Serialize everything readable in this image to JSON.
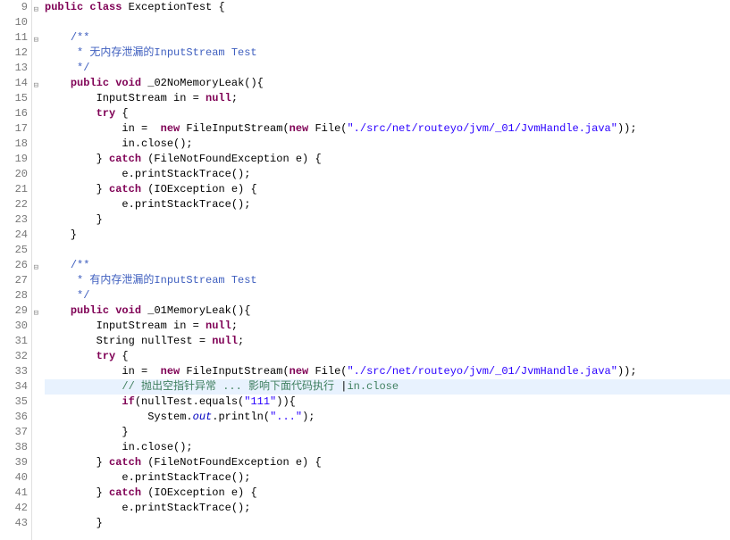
{
  "lines": [
    {
      "num": 9,
      "fold": "minus",
      "tokens": [
        [
          "kw",
          "public"
        ],
        [
          "normal",
          " "
        ],
        [
          "kw",
          "class"
        ],
        [
          "normal",
          " ExceptionTest {"
        ]
      ]
    },
    {
      "num": 10,
      "tokens": []
    },
    {
      "num": 11,
      "fold": "minus",
      "tokens": [
        [
          "normal",
          "    "
        ],
        [
          "jdoc",
          "/**"
        ]
      ]
    },
    {
      "num": 12,
      "tokens": [
        [
          "normal",
          "    "
        ],
        [
          "jdoc",
          " * 无内存泄漏的InputStream Test"
        ]
      ]
    },
    {
      "num": 13,
      "tokens": [
        [
          "normal",
          "    "
        ],
        [
          "jdoc",
          " */"
        ]
      ]
    },
    {
      "num": 14,
      "fold": "minus",
      "tokens": [
        [
          "normal",
          "    "
        ],
        [
          "kw",
          "public"
        ],
        [
          "normal",
          " "
        ],
        [
          "kw",
          "void"
        ],
        [
          "normal",
          " _02NoMemoryLeak(){"
        ]
      ]
    },
    {
      "num": 15,
      "tokens": [
        [
          "normal",
          "        InputStream in = "
        ],
        [
          "kw",
          "null"
        ],
        [
          "normal",
          ";"
        ]
      ]
    },
    {
      "num": 16,
      "tokens": [
        [
          "normal",
          "        "
        ],
        [
          "kw",
          "try"
        ],
        [
          "normal",
          " {"
        ]
      ]
    },
    {
      "num": 17,
      "tokens": [
        [
          "normal",
          "            in =  "
        ],
        [
          "kw",
          "new"
        ],
        [
          "normal",
          " FileInputStream("
        ],
        [
          "kw",
          "new"
        ],
        [
          "normal",
          " File("
        ],
        [
          "str",
          "\"./src/net/routeyo/jvm/_01/JvmHandle.java\""
        ],
        [
          "normal",
          "));"
        ]
      ]
    },
    {
      "num": 18,
      "tokens": [
        [
          "normal",
          "            in.close();"
        ]
      ]
    },
    {
      "num": 19,
      "tokens": [
        [
          "normal",
          "        } "
        ],
        [
          "kw",
          "catch"
        ],
        [
          "normal",
          " (FileNotFoundException e) {"
        ]
      ]
    },
    {
      "num": 20,
      "tokens": [
        [
          "normal",
          "            e.printStackTrace();"
        ]
      ]
    },
    {
      "num": 21,
      "tokens": [
        [
          "normal",
          "        } "
        ],
        [
          "kw",
          "catch"
        ],
        [
          "normal",
          " (IOException e) {"
        ]
      ]
    },
    {
      "num": 22,
      "tokens": [
        [
          "normal",
          "            e.printStackTrace();"
        ]
      ]
    },
    {
      "num": 23,
      "tokens": [
        [
          "normal",
          "        }"
        ]
      ]
    },
    {
      "num": 24,
      "tokens": [
        [
          "normal",
          "    }"
        ]
      ]
    },
    {
      "num": 25,
      "tokens": []
    },
    {
      "num": 26,
      "fold": "minus",
      "tokens": [
        [
          "normal",
          "    "
        ],
        [
          "jdoc",
          "/**"
        ]
      ]
    },
    {
      "num": 27,
      "tokens": [
        [
          "normal",
          "    "
        ],
        [
          "jdoc",
          " * 有内存泄漏的InputStream Test"
        ]
      ]
    },
    {
      "num": 28,
      "tokens": [
        [
          "normal",
          "    "
        ],
        [
          "jdoc",
          " */"
        ]
      ]
    },
    {
      "num": 29,
      "fold": "minus",
      "tokens": [
        [
          "normal",
          "    "
        ],
        [
          "kw",
          "public"
        ],
        [
          "normal",
          " "
        ],
        [
          "kw",
          "void"
        ],
        [
          "normal",
          " _01MemoryLeak(){"
        ]
      ]
    },
    {
      "num": 30,
      "tokens": [
        [
          "normal",
          "        InputStream in = "
        ],
        [
          "kw",
          "null"
        ],
        [
          "normal",
          ";"
        ]
      ]
    },
    {
      "num": 31,
      "tokens": [
        [
          "normal",
          "        String nullTest = "
        ],
        [
          "kw",
          "null"
        ],
        [
          "normal",
          ";"
        ]
      ]
    },
    {
      "num": 32,
      "tokens": [
        [
          "normal",
          "        "
        ],
        [
          "kw",
          "try"
        ],
        [
          "normal",
          " {"
        ]
      ]
    },
    {
      "num": 33,
      "tokens": [
        [
          "normal",
          "            in =  "
        ],
        [
          "kw",
          "new"
        ],
        [
          "normal",
          " FileInputStream("
        ],
        [
          "kw",
          "new"
        ],
        [
          "normal",
          " File("
        ],
        [
          "str",
          "\"./src/net/routeyo/jvm/_01/JvmHandle.java\""
        ],
        [
          "normal",
          "));"
        ]
      ]
    },
    {
      "num": 34,
      "highlight": true,
      "tokens": [
        [
          "normal",
          "            "
        ],
        [
          "cmt",
          "// 抛出空指针异常 ... 影响下面代码执行 "
        ],
        [
          "normal",
          "|"
        ],
        [
          "cmt",
          "in.close"
        ]
      ]
    },
    {
      "num": 35,
      "tokens": [
        [
          "normal",
          "            "
        ],
        [
          "kw",
          "if"
        ],
        [
          "normal",
          "(nullTest.equals("
        ],
        [
          "str",
          "\"111\""
        ],
        [
          "normal",
          ")){"
        ]
      ]
    },
    {
      "num": 36,
      "tokens": [
        [
          "normal",
          "                System."
        ],
        [
          "static-field",
          "out"
        ],
        [
          "normal",
          ".println("
        ],
        [
          "str",
          "\"...\""
        ],
        [
          "normal",
          ");"
        ]
      ]
    },
    {
      "num": 37,
      "tokens": [
        [
          "normal",
          "            }"
        ]
      ]
    },
    {
      "num": 38,
      "tokens": [
        [
          "normal",
          "            in.close();"
        ]
      ]
    },
    {
      "num": 39,
      "tokens": [
        [
          "normal",
          "        } "
        ],
        [
          "kw",
          "catch"
        ],
        [
          "normal",
          " (FileNotFoundException e) {"
        ]
      ]
    },
    {
      "num": 40,
      "tokens": [
        [
          "normal",
          "            e.printStackTrace();"
        ]
      ]
    },
    {
      "num": 41,
      "tokens": [
        [
          "normal",
          "        } "
        ],
        [
          "kw",
          "catch"
        ],
        [
          "normal",
          " (IOException e) {"
        ]
      ]
    },
    {
      "num": 42,
      "tokens": [
        [
          "normal",
          "            e.printStackTrace();"
        ]
      ]
    },
    {
      "num": 43,
      "tokens": [
        [
          "normal",
          "        }"
        ]
      ]
    }
  ]
}
